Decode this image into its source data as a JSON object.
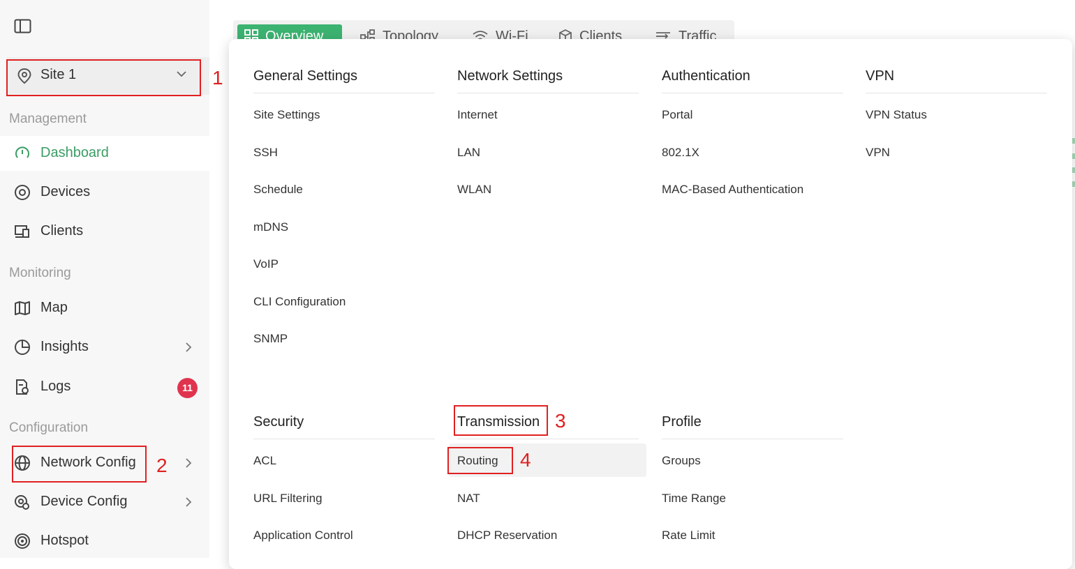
{
  "sidebar": {
    "site": {
      "name": "Site 1",
      "icon": "location-pin-icon"
    },
    "sections": {
      "management": "Management",
      "monitoring": "Monitoring",
      "configuration": "Configuration"
    },
    "items": {
      "dashboard": "Dashboard",
      "devices": "Devices",
      "clients": "Clients",
      "map": "Map",
      "insights": "Insights",
      "logs": "Logs",
      "logs_badge": "11",
      "network_config": "Network Config",
      "device_config": "Device Config",
      "hotspot": "Hotspot"
    }
  },
  "tabs": [
    "Overview",
    "Topology",
    "Wi-Fi",
    "Clients",
    "Traffic"
  ],
  "menu": {
    "general": {
      "title": "General Settings",
      "items": [
        "Site Settings",
        "SSH",
        "Schedule",
        "mDNS",
        "VoIP",
        "CLI Configuration",
        "SNMP"
      ]
    },
    "network": {
      "title": "Network Settings",
      "items": [
        "Internet",
        "LAN",
        "WLAN"
      ]
    },
    "authentication": {
      "title": "Authentication",
      "items": [
        "Portal",
        "802.1X",
        "MAC-Based Authentication"
      ]
    },
    "vpn": {
      "title": "VPN",
      "items": [
        "VPN Status",
        "VPN"
      ]
    },
    "security": {
      "title": "Security",
      "items": [
        "ACL",
        "URL Filtering",
        "Application Control"
      ]
    },
    "transmission": {
      "title": "Transmission",
      "items": [
        "Routing",
        "NAT",
        "DHCP Reservation"
      ]
    },
    "profile": {
      "title": "Profile",
      "items": [
        "Groups",
        "Time Range",
        "Rate Limit"
      ]
    }
  },
  "annotations": [
    "1",
    "2",
    "3",
    "4"
  ],
  "colors": {
    "accent": "#3cb371",
    "active_text": "#3a9d64",
    "badge": "#e0344e",
    "annotation": "#e02020"
  }
}
